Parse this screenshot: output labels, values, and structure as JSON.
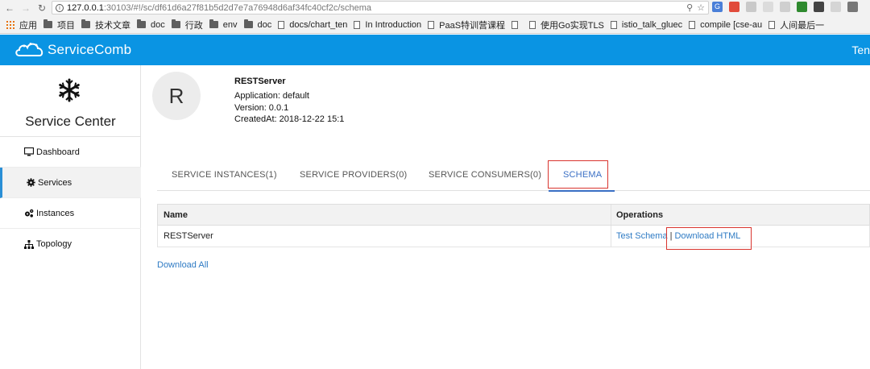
{
  "browser": {
    "url_host": "127.0.0.1",
    "url_rest": ":30103/#!/sc/df61d6a27f81b5d2d7e7a76948d6af34fc40cf2c/schema",
    "bookmarks": [
      {
        "label": "应用",
        "kind": "apps"
      },
      {
        "label": "项目",
        "kind": "folder"
      },
      {
        "label": "技术文章",
        "kind": "folder"
      },
      {
        "label": "doc",
        "kind": "folder"
      },
      {
        "label": "行政",
        "kind": "folder"
      },
      {
        "label": "env",
        "kind": "folder"
      },
      {
        "label": "doc",
        "kind": "folder"
      },
      {
        "label": "docs/chart_ten",
        "kind": "page"
      },
      {
        "label": "In Introduction",
        "kind": "page"
      },
      {
        "label": "PaaS特训营课程",
        "kind": "page"
      },
      {
        "label": "",
        "kind": "page"
      },
      {
        "label": "使用Go实现TLS",
        "kind": "page"
      },
      {
        "label": "istio_talk_gluec",
        "kind": "page"
      },
      {
        "label": "compile [cse-au",
        "kind": "page"
      },
      {
        "label": "人间最后一",
        "kind": "page"
      }
    ]
  },
  "header": {
    "logo_text": "ServiceComb",
    "tenant_label": "Ten"
  },
  "sidebar": {
    "title": "Service Center",
    "items": [
      {
        "label": "Dashboard",
        "icon": "monitor-icon",
        "active": false
      },
      {
        "label": "Services",
        "icon": "gear-icon",
        "active": true
      },
      {
        "label": "Instances",
        "icon": "gears-icon",
        "active": false
      },
      {
        "label": "Topology",
        "icon": "sitemap-icon",
        "active": false
      }
    ]
  },
  "service": {
    "avatar_letter": "R",
    "name": "RESTServer",
    "application": "Application: default",
    "version": "Version: 0.0.1",
    "created_at": "CreatedAt: 2018-12-22 15:1"
  },
  "tabs": [
    {
      "label": "SERVICE INSTANCES(1)",
      "active": false
    },
    {
      "label": "SERVICE PROVIDERS(0)",
      "active": false
    },
    {
      "label": "SERVICE CONSUMERS(0)",
      "active": false
    },
    {
      "label": "SCHEMA",
      "active": true
    }
  ],
  "schema_table": {
    "headers": [
      "Name",
      "Operations"
    ],
    "rows": [
      {
        "name": "RESTServer",
        "test_link": "Test Schema",
        "separator": "|",
        "download_link": "Download HTML"
      }
    ]
  },
  "download_all_label": "Download All",
  "colors": {
    "header_bg": "#0a94e3",
    "link": "#2f7bc4",
    "highlight": "#d9352f",
    "tab_active": "#3a6fc4"
  }
}
